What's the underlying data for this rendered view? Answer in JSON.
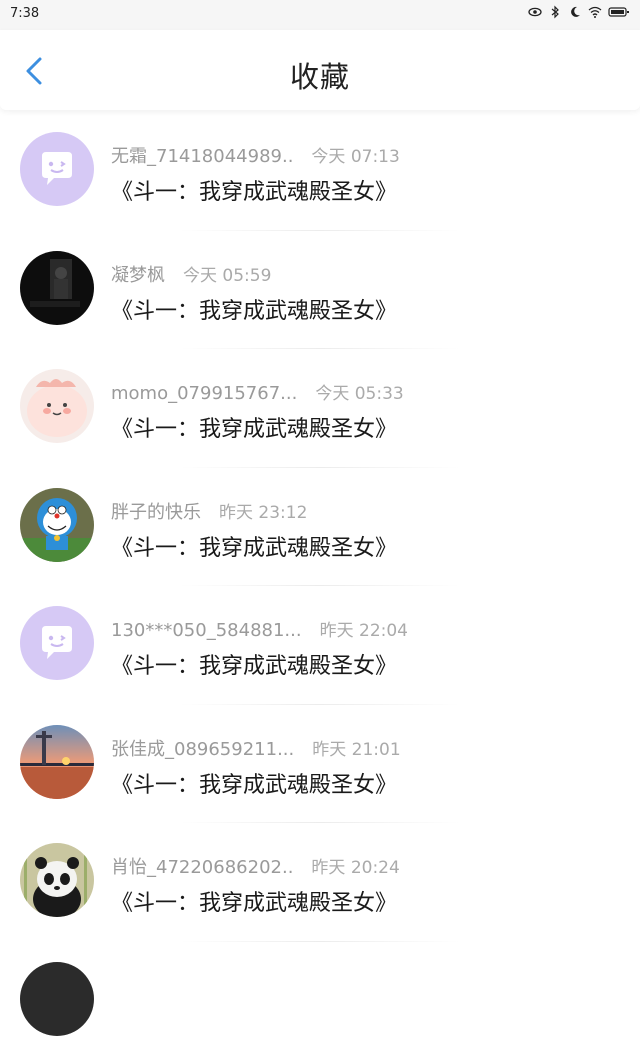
{
  "status_bar": {
    "time": "7:38"
  },
  "header": {
    "title": "收藏"
  },
  "items": [
    {
      "name": "无霜_71418044989..",
      "time": "今天 07:13",
      "book": "《斗一：我穿成武魂殿圣女》",
      "avatar": "chat-bubble-default"
    },
    {
      "name": "凝梦枫",
      "time": "今天 05:59",
      "book": "《斗一：我穿成武魂殿圣女》",
      "avatar": "dark-photo"
    },
    {
      "name": "momo_079915767...",
      "time": "今天 05:33",
      "book": "《斗一：我穿成武魂殿圣女》",
      "avatar": "pink-cartoon"
    },
    {
      "name": "胖子的快乐",
      "time": "昨天 23:12",
      "book": "《斗一：我穿成武魂殿圣女》",
      "avatar": "doraemon"
    },
    {
      "name": "130***050_584881...",
      "time": "昨天 22:04",
      "book": "《斗一：我穿成武魂殿圣女》",
      "avatar": "chat-bubble-default"
    },
    {
      "name": "张佳成_089659211...",
      "time": "昨天 21:01",
      "book": "《斗一：我穿成武魂殿圣女》",
      "avatar": "sunset"
    },
    {
      "name": "肖怡_47220686202..",
      "time": "昨天 20:24",
      "book": "《斗一：我穿成武魂殿圣女》",
      "avatar": "panda"
    }
  ],
  "colors": {
    "accent": "#3d8fe0",
    "default_avatar_bg": "#d6c9f5",
    "title": "#222222",
    "meta": "#9a9a9a"
  }
}
